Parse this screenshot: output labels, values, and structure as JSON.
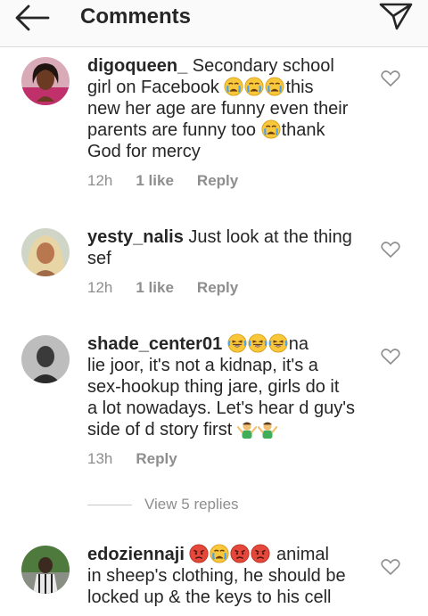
{
  "header": {
    "title": "Comments"
  },
  "comments": [
    {
      "username": "digoqueen_",
      "lines": [
        "Secondary school",
        "girl on Facebook",
        "this",
        "new her age are funny even their",
        "parents are funny too",
        "thank",
        "God for mercy"
      ],
      "time": "12h",
      "likes": "1 like",
      "reply": "Reply"
    },
    {
      "username": "yesty_nalis",
      "lines": [
        "Just look at the thing",
        "sef"
      ],
      "time": "12h",
      "likes": "1 like",
      "reply": "Reply"
    },
    {
      "username": "shade_center01",
      "lines": [
        "na",
        "lie joor, it's not a kidnap, it's a",
        "sex-hookup thing jare, girls do it",
        "a lot nowadays. Let's hear d guy's",
        "side of d story first"
      ],
      "time": "13h",
      "reply": "Reply"
    },
    {
      "username": "edoziennaji",
      "lines": [
        "animal",
        "in sheep's clothing, he should be",
        "locked up & the keys to his cell"
      ]
    }
  ],
  "view_replies": "View 5 replies",
  "colors": {
    "text": "#262626",
    "secondary": "#8e8e8e",
    "header_bg": "#fafafa",
    "divider": "#dbdbdb"
  },
  "icons": [
    "back-arrow-icon",
    "send-icon",
    "heart-icon",
    "crying-emoji",
    "laughing-emoji",
    "angry-emoji",
    "shrug-emoji"
  ]
}
